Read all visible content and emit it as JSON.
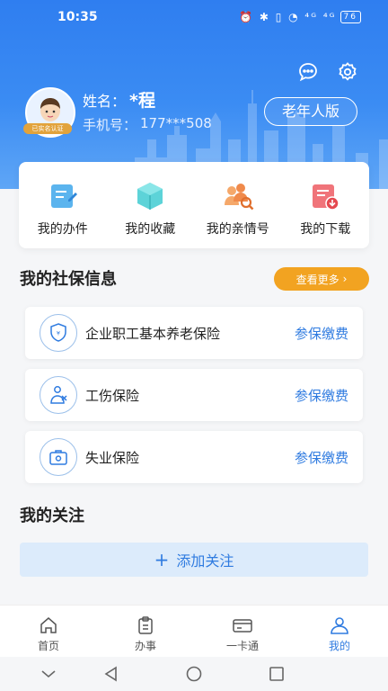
{
  "status_bar": {
    "time": "10:35",
    "icons": "⏰ ✱ ▯ ◔ ⁴ᴳ ⁴ᴳ",
    "battery": "76"
  },
  "user": {
    "avatar_badge": "已实名认证",
    "name_label": "姓名：",
    "name_value": "*程",
    "phone_label": "手机号：",
    "phone_value": "177***508",
    "elder_mode": "老年人版"
  },
  "quick_actions": [
    {
      "label": "我的办件",
      "icon": "pen-document-icon"
    },
    {
      "label": "我的收藏",
      "icon": "box-icon"
    },
    {
      "label": "我的亲情号",
      "icon": "family-search-icon"
    },
    {
      "label": "我的下载",
      "icon": "download-document-icon"
    }
  ],
  "social_security": {
    "title": "我的社保信息",
    "more_label": "查看更多",
    "items": [
      {
        "name": "企业职工基本养老保险",
        "action": "参保缴费",
        "icon": "pension-shield-icon"
      },
      {
        "name": "工伤保险",
        "action": "参保缴费",
        "icon": "injury-icon"
      },
      {
        "name": "失业保险",
        "action": "参保缴费",
        "icon": "briefcase-icon"
      }
    ]
  },
  "follow": {
    "title": "我的关注",
    "add_label": "添加关注"
  },
  "tabbar": [
    {
      "label": "首页",
      "icon": "home-icon"
    },
    {
      "label": "办事",
      "icon": "clipboard-icon"
    },
    {
      "label": "一卡通",
      "icon": "card-icon"
    },
    {
      "label": "我的",
      "icon": "user-icon"
    }
  ],
  "colors": {
    "brand_blue": "#2f7be0",
    "accent_orange": "#f2a321",
    "follow_bg": "#dcebfb"
  }
}
